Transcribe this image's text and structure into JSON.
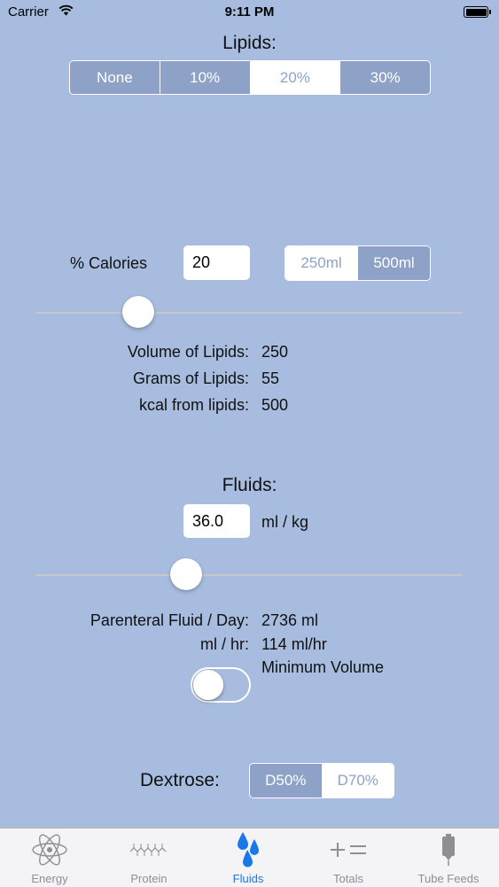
{
  "status_bar": {
    "carrier": "Carrier",
    "time": "9:11 PM"
  },
  "lipids": {
    "title": "Lipids:",
    "options": [
      "None",
      "10%",
      "20%",
      "30%"
    ],
    "selected": "20%",
    "calories_label": "% Calories",
    "calories_value": "20",
    "volume_options": [
      "250ml",
      "500ml"
    ],
    "volume_selected": "500ml",
    "slider_fraction": 0.22,
    "results": [
      {
        "label": "Volume of Lipids:",
        "value": "250"
      },
      {
        "label": "Grams of Lipids:",
        "value": "55"
      },
      {
        "label": "kcal from lipids:",
        "value": "500"
      }
    ]
  },
  "fluids": {
    "title": "Fluids:",
    "value": "36.0",
    "unit": "ml / kg",
    "slider_fraction": 0.34,
    "day_label": "Parenteral Fluid / Day:",
    "day_value": "2736 ml",
    "hour_label": "ml / hr:",
    "hour_value": "114 ml/hr",
    "min_volume_label": "Minimum Volume",
    "min_volume_on": false
  },
  "dextrose": {
    "title": "Dextrose:",
    "options": [
      "D50%",
      "D70%"
    ],
    "selected": "D50%"
  },
  "tabs": [
    {
      "label": "Energy",
      "icon": "atom-icon"
    },
    {
      "label": "Protein",
      "icon": "protein-chain-icon"
    },
    {
      "label": "Fluids",
      "icon": "droplets-icon",
      "active": true
    },
    {
      "label": "Totals",
      "icon": "plus-equals-icon"
    },
    {
      "label": "Tube Feeds",
      "icon": "feeding-tube-icon"
    }
  ],
  "colors": {
    "background": "#a7bcde",
    "segment_fill": "#8da2c6",
    "active_tab": "#1a78e8"
  }
}
